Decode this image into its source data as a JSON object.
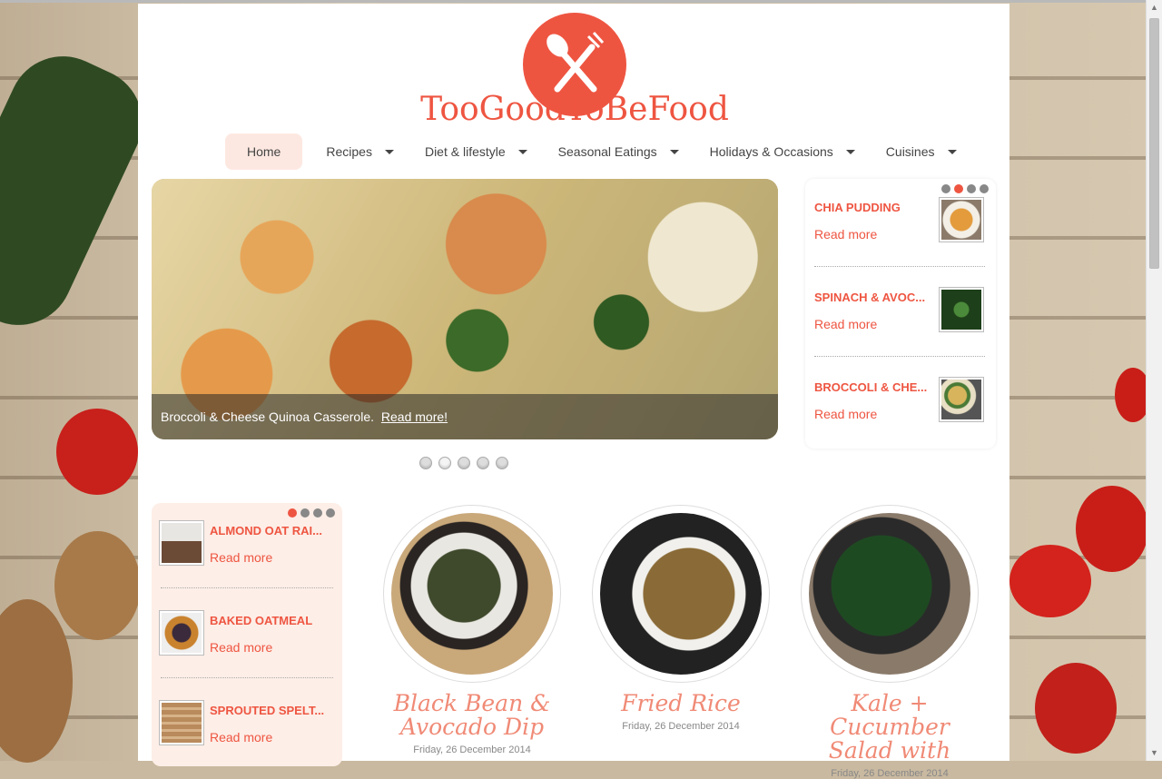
{
  "site": {
    "name": "TooGoodToBeFood"
  },
  "nav": {
    "home": "Home",
    "recipes": "Recipes",
    "diet": "Diet & lifestyle",
    "seasonal": "Seasonal Eatings",
    "holidays": "Holidays & Occasions",
    "cuisines": "Cuisines"
  },
  "slider": {
    "caption": "Broccoli & Cheese Quinoa Casserole.",
    "link": "Read more!"
  },
  "side_box": {
    "items": [
      {
        "title": "CHIA PUDDING",
        "read_more": "Read more"
      },
      {
        "title": "SPINACH & AVOC...",
        "read_more": "Read more"
      },
      {
        "title": "BROCCOLI & CHE...",
        "read_more": "Read more"
      }
    ]
  },
  "left_box": {
    "items": [
      {
        "title": "ALMOND OAT RAI...",
        "read_more": "Read more"
      },
      {
        "title": "BAKED OATMEAL",
        "read_more": "Read more"
      },
      {
        "title": "SPROUTED SPELT...",
        "read_more": "Read more"
      }
    ]
  },
  "recipes": [
    {
      "title": "Black Bean & Avocado Dip",
      "date": "Friday, 26 December 2014"
    },
    {
      "title": "Fried Rice",
      "date": "Friday, 26 December 2014"
    },
    {
      "title": "Kale + Cucumber Salad with",
      "date": "Friday, 26 December 2014"
    }
  ],
  "colors": {
    "accent": "#ee5541",
    "soft_accent": "#fde8e1"
  }
}
